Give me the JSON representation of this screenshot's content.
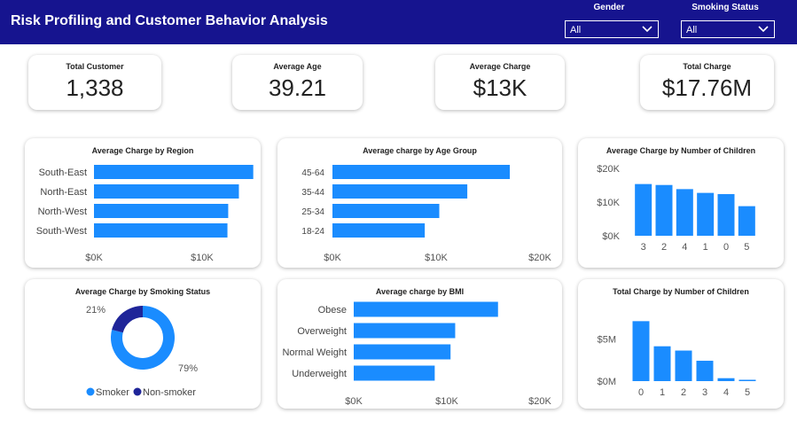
{
  "header": {
    "title": "Risk Profiling and Customer Behavior Analysis",
    "slicers": [
      {
        "label": "Gender",
        "value": "All"
      },
      {
        "label": "Smoking Status",
        "value": "All"
      }
    ]
  },
  "colors": {
    "header_bg": "#16148f",
    "bar": "#1a8cff",
    "smoker": "#1a8cff",
    "non_smoker": "#1f2599"
  },
  "kpis": [
    {
      "label": "Total Customer",
      "value": "1,338"
    },
    {
      "label": "Average Age",
      "value": "39.21"
    },
    {
      "label": "Average Charge",
      "value": "$13K"
    },
    {
      "label": "Total Charge",
      "value": "$17.76M"
    }
  ],
  "chart_data": [
    {
      "type": "bar",
      "orientation": "horizontal",
      "title": "Average Charge by Region",
      "categories": [
        "South-East",
        "North-East",
        "North-West",
        "South-West"
      ],
      "values": [
        14735,
        13406,
        12418,
        12347
      ],
      "xlim": [
        0,
        15500
      ],
      "ticks": [
        {
          "v": 0,
          "label": "$0K"
        },
        {
          "v": 10000,
          "label": "$10K"
        }
      ]
    },
    {
      "type": "bar",
      "orientation": "horizontal",
      "title": "Average charge by Age Group",
      "categories": [
        "45-64",
        "35-44",
        "25-34",
        "18-24"
      ],
      "values": [
        17100,
        13000,
        10300,
        8900
      ],
      "xlim": [
        0,
        20000
      ],
      "ticks": [
        {
          "v": 0,
          "label": "$0K"
        },
        {
          "v": 10000,
          "label": "$10K"
        },
        {
          "v": 20000,
          "label": "$20K"
        }
      ]
    },
    {
      "type": "bar",
      "orientation": "vertical",
      "title": "Average Charge by Number of Children",
      "categories": [
        "3",
        "2",
        "4",
        "1",
        "0",
        "5"
      ],
      "values": [
        15355,
        15074,
        13851,
        12731,
        12366,
        8786
      ],
      "ylim": [
        0,
        20000
      ],
      "ticks": [
        {
          "v": 0,
          "label": "$0K"
        },
        {
          "v": 10000,
          "label": "$10K"
        },
        {
          "v": 20000,
          "label": "$20K"
        }
      ]
    },
    {
      "type": "pie",
      "title": "Average Charge by Smoking Status",
      "slices": [
        {
          "name": "Smoker",
          "value": 79,
          "label": "79%"
        },
        {
          "name": "Non-smoker",
          "value": 21,
          "label": "21%"
        }
      ],
      "legend": "bottom"
    },
    {
      "type": "bar",
      "orientation": "horizontal",
      "title": "Average charge by BMI",
      "categories": [
        "Obese",
        "Overweight",
        "Normal Weight",
        "Underweight"
      ],
      "values": [
        15500,
        10900,
        10400,
        8700
      ],
      "xlim": [
        0,
        20000
      ],
      "ticks": [
        {
          "v": 0,
          "label": "$0K"
        },
        {
          "v": 10000,
          "label": "$10K"
        },
        {
          "v": 20000,
          "label": "$20K"
        }
      ]
    },
    {
      "type": "bar",
      "orientation": "vertical",
      "title": "Total Charge by Number of Children",
      "categories": [
        "0",
        "1",
        "2",
        "3",
        "4",
        "5"
      ],
      "values": [
        7098070,
        4124899,
        3617655,
        2410785,
        346266,
        158149
      ],
      "ylim": [
        0,
        8500000
      ],
      "ticks": [
        {
          "v": 0,
          "label": "$0M"
        },
        {
          "v": 5000000,
          "label": "$5M"
        }
      ]
    }
  ]
}
